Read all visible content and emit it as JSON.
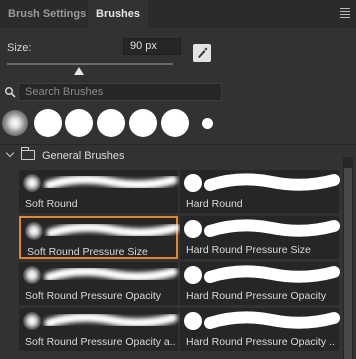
{
  "tabs": [
    {
      "label": "Brush Settings",
      "active": false
    },
    {
      "label": "Brushes",
      "active": true
    }
  ],
  "size": {
    "label": "Size:",
    "value": "90 px",
    "slider_fraction": 0.45
  },
  "search": {
    "placeholder": "Search Brushes"
  },
  "presets": [
    "soft",
    "hard",
    "hard",
    "hard",
    "hard",
    "hard",
    "hard"
  ],
  "group": {
    "label": "General Brushes",
    "expanded": true
  },
  "brushes": [
    {
      "label": "Soft Round",
      "type": "soft",
      "selected": false
    },
    {
      "label": "Hard Round",
      "type": "hard",
      "selected": false
    },
    {
      "label": "Soft Round Pressure Size",
      "type": "soft",
      "selected": true
    },
    {
      "label": "Hard Round Pressure Size",
      "type": "hard",
      "selected": false
    },
    {
      "label": "Soft Round Pressure Opacity",
      "type": "soft",
      "selected": false
    },
    {
      "label": "Hard Round Pressure Opacity",
      "type": "hard",
      "selected": false
    },
    {
      "label": "Soft Round Pressure Opacity a...",
      "type": "soft",
      "selected": false
    },
    {
      "label": "Hard Round Pressure Opacity ...",
      "type": "hard",
      "selected": false
    }
  ],
  "colors": {
    "panel": "#323232",
    "tile": "#262626",
    "selection": "#e0862e"
  }
}
